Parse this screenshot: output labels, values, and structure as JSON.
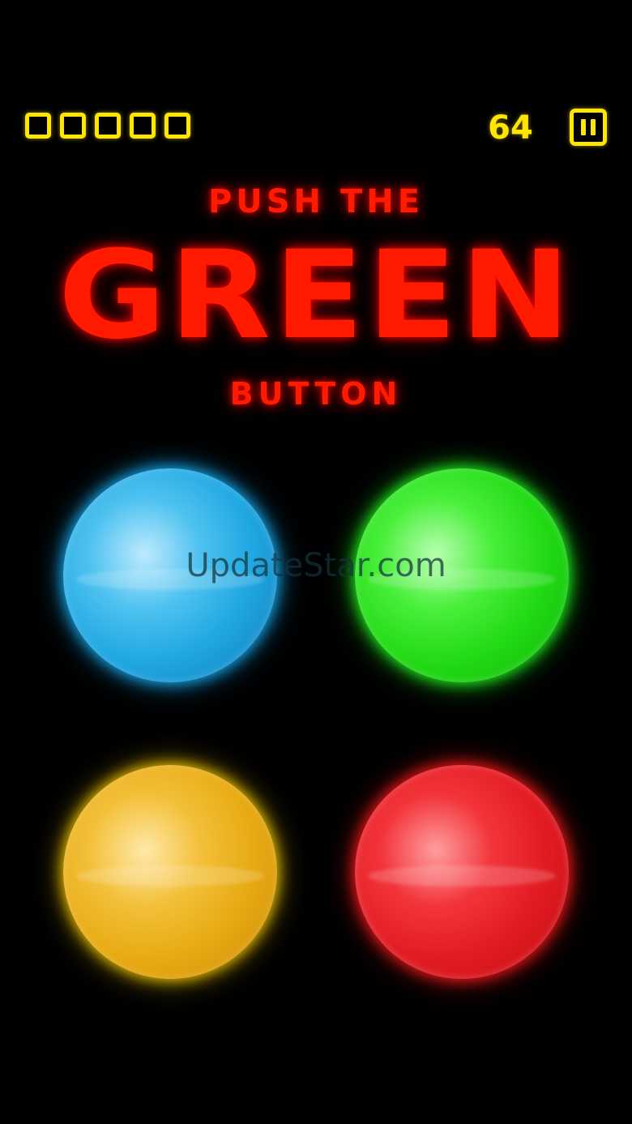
{
  "hud": {
    "lives_total": 5,
    "score": "64",
    "pause_icon": "pause-icon",
    "accent_color": "#ffe600"
  },
  "instruction": {
    "line_top": "PUSH THE",
    "line_main": "GREEN",
    "line_bottom": "BUTTON",
    "text_color": "#ff1a00"
  },
  "buttons": [
    {
      "color_name": "blue",
      "color": "#20a8e2"
    },
    {
      "color_name": "green",
      "color": "#23db16"
    },
    {
      "color_name": "yellow",
      "color": "#e8ab14"
    },
    {
      "color_name": "red",
      "color": "#e31c24"
    }
  ],
  "watermark": "UpdateStar.com"
}
